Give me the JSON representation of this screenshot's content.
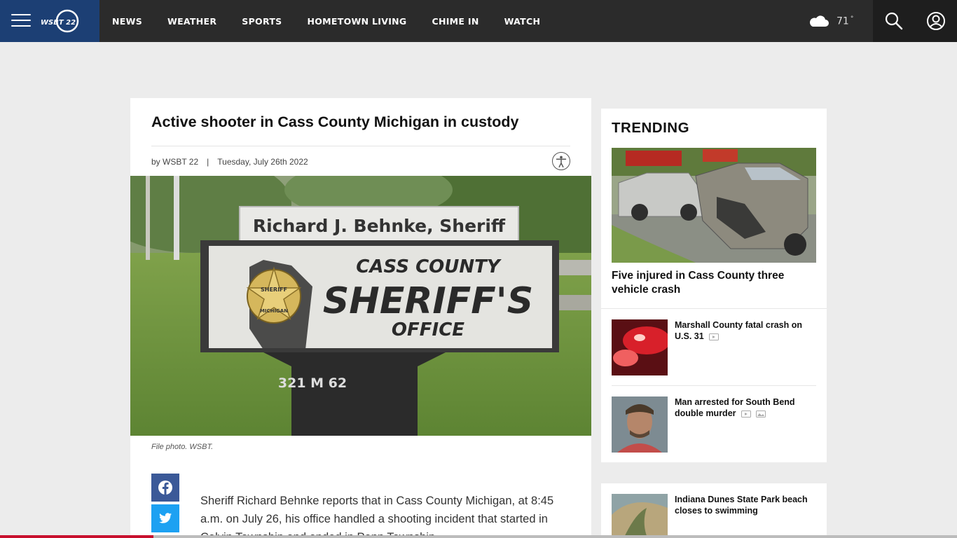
{
  "header": {
    "logo_text": "WSBT 22",
    "nav": [
      "NEWS",
      "WEATHER",
      "SPORTS",
      "HOMETOWN LIVING",
      "CHIME IN",
      "WATCH"
    ],
    "weather": {
      "temp": "71",
      "unit": "°",
      "icon": "cloud-icon"
    },
    "colors": {
      "bar": "#2b2b2b",
      "brand": "#1c3f74"
    }
  },
  "article": {
    "headline": "Active shooter in Cass County Michigan in custody",
    "byline": "by WSBT 22",
    "separator": "|",
    "date": "Tuesday, July 26th 2022",
    "hero_image": {
      "sign_top": "Richard J. Behnke, Sheriff",
      "sign_line1": "CASS COUNTY",
      "sign_line2": "SHERIFF'S",
      "sign_line3": "OFFICE",
      "badge_top": "SHERIFF",
      "badge_bottom": "MICHIGAN",
      "address": "321 M 62"
    },
    "caption": "File photo. WSBT.",
    "body": "Sheriff Richard Behnke reports that in Cass County Michigan, at 8:45 a.m. on July 26, his office handled a shooting incident that started in Calvin Township and ended in Penn Township."
  },
  "trending": {
    "heading": "TRENDING",
    "lead": {
      "title": "Five injured in Cass County three vehicle crash"
    },
    "items": [
      {
        "title": "Marshall County fatal crash on U.S. 31",
        "badges": [
          "video-icon"
        ]
      },
      {
        "title": "Man arrested for South Bend double murder",
        "badges": [
          "video-icon",
          "gallery-icon"
        ]
      },
      {
        "title": "Indiana Dunes State Park beach closes to swimming",
        "badges": []
      }
    ]
  },
  "progress": {
    "fraction": 0.16,
    "color": "#c8102e"
  }
}
